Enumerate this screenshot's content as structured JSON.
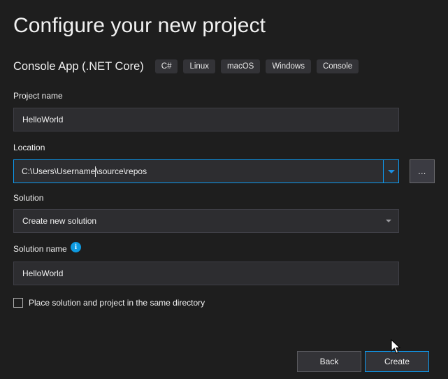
{
  "header": {
    "title": "Configure your new project",
    "subtitle": "Console App (.NET Core)",
    "tags": [
      "C#",
      "Linux",
      "macOS",
      "Windows",
      "Console"
    ]
  },
  "form": {
    "project_name": {
      "label": "Project name",
      "value": "HelloWorld"
    },
    "location": {
      "label": "Location",
      "value_before_caret": "C:\\Users\\Username",
      "value_after_caret": "\\source\\repos",
      "value": "C:\\Users\\Username\\source\\repos",
      "browse_label": "...",
      "dropdown_icon": "chevron-down-icon"
    },
    "solution": {
      "label": "Solution",
      "selected": "Create new solution",
      "dropdown_icon": "chevron-down-icon"
    },
    "solution_name": {
      "label": "Solution name",
      "info_icon": "info-icon",
      "info_glyph": "i",
      "value": "HelloWorld"
    },
    "same_directory": {
      "label": "Place solution and project in the same directory",
      "checked": false
    }
  },
  "footer": {
    "back_label": "Back",
    "create_label": "Create"
  },
  "colors": {
    "background": "#1e1e1e",
    "input_background": "#2d2d30",
    "input_border": "#3f3f46",
    "focus_accent": "#0d9bf2",
    "tag_background": "#333337",
    "text": "#f0f0f0",
    "info_blue": "#0e9ae0"
  }
}
